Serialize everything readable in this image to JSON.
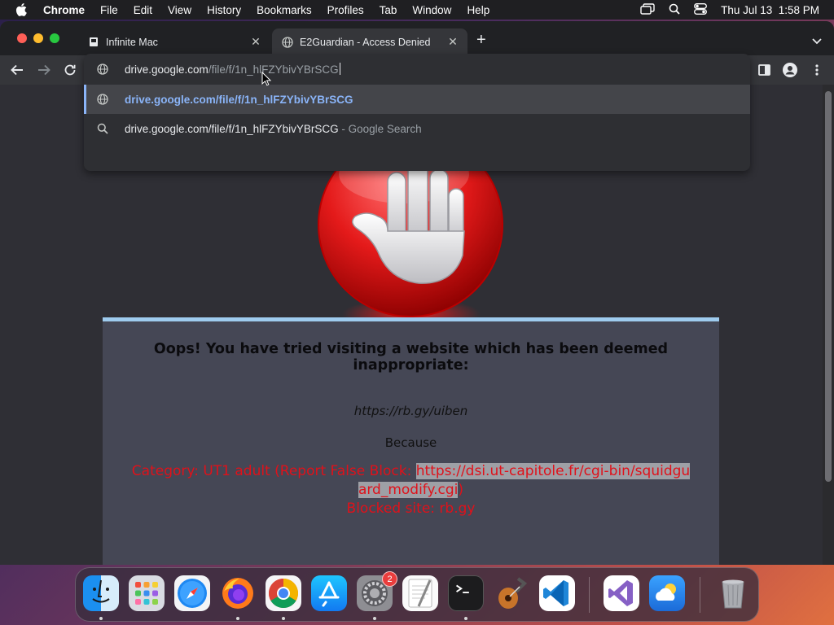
{
  "menubar": {
    "app": "Chrome",
    "items": [
      "File",
      "Edit",
      "View",
      "History",
      "Bookmarks",
      "Profiles",
      "Tab",
      "Window",
      "Help"
    ],
    "clock": "Thu Jul 13  1:58 PM"
  },
  "tabs": [
    {
      "title": "Infinite Mac",
      "icon": "page-icon"
    },
    {
      "title": "E2Guardian - Access Denied",
      "icon": "globe-icon"
    }
  ],
  "omnibox": {
    "typed_host": "drive.google.com",
    "typed_path": "/file/f/1n_hlFZYbivYBrSCG",
    "suggestions": [
      {
        "text": "drive.google.com/file/f/1n_hlFZYbivYBrSCG",
        "suffix": "",
        "icon": "globe-icon"
      },
      {
        "text": "drive.google.com/file/f/1n_hlFZYbivYBrSCG",
        "suffix": " - Google Search",
        "icon": "search-icon"
      }
    ]
  },
  "page": {
    "heading": "Oops! You have tried visiting a website which has been deemed inappropriate:",
    "blocked_url": "https://rb.gy/uiben",
    "because": "Because",
    "category_label": "Category: UT1 adult (Report False Block: ",
    "report_link_line1": "https://dsi.ut-capitole.fr/cgi-bin/squidgu",
    "report_link_line2": "ard_modify.cgi",
    "category_close": ")",
    "blocked_site": "Blocked site: rb.gy"
  },
  "dock": {
    "apps": [
      "Finder",
      "Launchpad",
      "Safari",
      "Firefox",
      "Google Chrome",
      "App Store",
      "System Settings",
      "TextEdit",
      "Terminal",
      "GarageBand",
      "Visual Studio Code",
      "Visual Studio",
      "Weather",
      "Trash"
    ],
    "settings_badge": "2"
  },
  "colors": {
    "accent": "#8ab4f8",
    "block_red": "#e0111a",
    "panel_border": "#9ecbee"
  }
}
